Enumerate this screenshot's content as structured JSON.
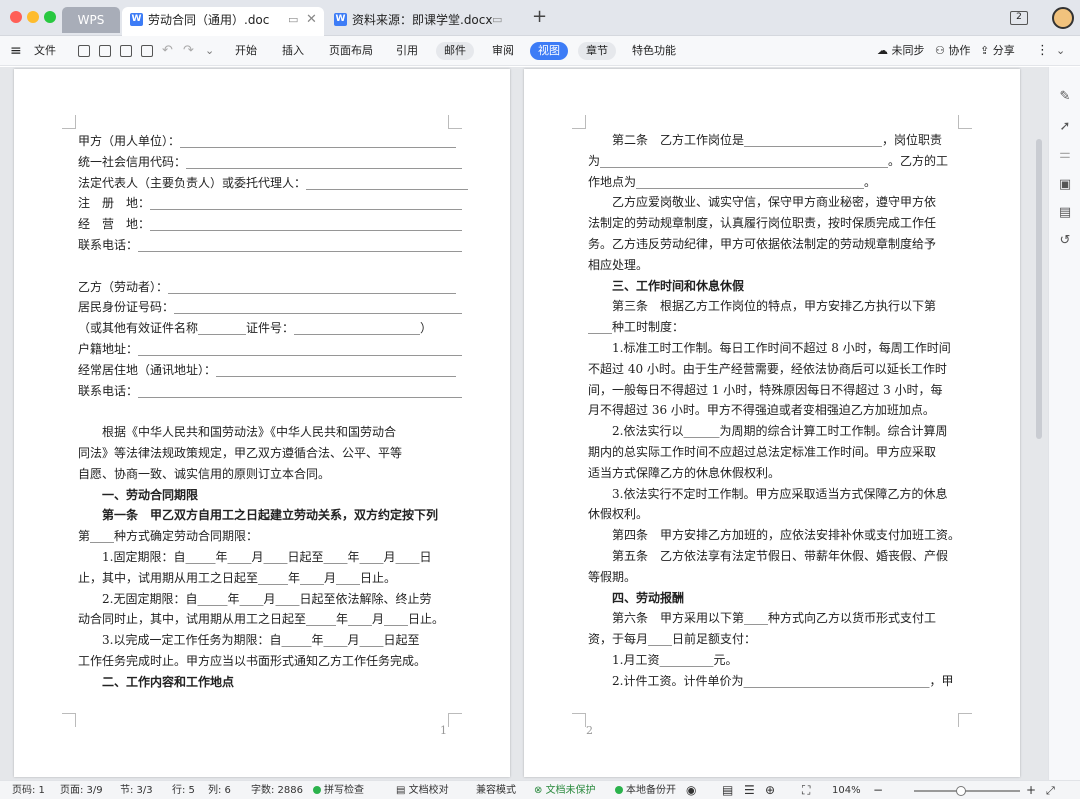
{
  "app": {
    "name": "WPS"
  },
  "tabs": [
    {
      "label": "劳动合同（通用）.doc",
      "icon": "word-doc-icon"
    },
    {
      "label": "资料来源：即课学堂.docx",
      "icon": "word-doc-icon"
    }
  ],
  "titlebar": {
    "badge": "2"
  },
  "menu": {
    "file": "文件",
    "items": [
      "开始",
      "插入",
      "页面布局",
      "引用",
      "邮件",
      "审阅",
      "视图",
      "章节",
      "特色功能"
    ],
    "active": "视图",
    "sync": "未同步",
    "collab": "协作",
    "share": "分享"
  },
  "page1": {
    "lines": [
      "甲方（用人单位）：______________________________________________",
      "统一社会信用代码：______________________________________________",
      "法定代表人（主要负责人）或委托代理人：___________________________",
      "注　册　地：____________________________________________________",
      "经　营　地：____________________________________________________",
      "联系电话：______________________________________________________",
      "",
      "乙方（劳动者）：________________________________________________",
      "居民身份证号码：________________________________________________",
      "（或其他有效证件名称________证件号：_____________________）",
      "户籍地址：______________________________________________________",
      "经常居住地（通讯地址）：________________________________________",
      "联系电话：______________________________________________________",
      "",
      "　　根据《中华人民共和国劳动法》《中华人民共和国劳动合",
      "同法》等法律法规政策规定，甲乙双方遵循合法、公平、平等",
      "自愿、协商一致、诚实信用的原则订立本合同。",
      "　　一、劳动合同期限",
      "　　第一条　甲乙双方自用工之日起建立劳动关系，双方约定按下列",
      "第____种方式确定劳动合同期限：",
      "　　1.固定期限：自_____年____月____日起至____年____月____日",
      "止，其中，试用期从用工之日起至_____年____月____日止。",
      "　　2.无固定期限：自_____年____月____日起至依法解除、终止劳",
      "动合同时止，其中，试用期从用工之日起至_____年____月____日止。",
      "　　3.以完成一定工作任务为期限：自_____年____月____日起至",
      "工作任务完成时止。甲方应当以书面形式通知乙方工作任务完成。",
      "　　二、工作内容和工作地点"
    ],
    "bold": [
      17,
      18,
      26
    ],
    "page_number": "1"
  },
  "page2": {
    "lines": [
      "　　第二条　乙方工作岗位是_______________________，岗位职责",
      "为________________________________________________。乙方的工",
      "作地点为______________________________________。",
      "　　乙方应爱岗敬业、诚实守信，保守甲方商业秘密，遵守甲方依",
      "法制定的劳动规章制度，认真履行岗位职责，按时保质完成工作任",
      "务。乙方违反劳动纪律，甲方可依据依法制定的劳动规章制度给予",
      "相应处理。",
      "　　三、工作时间和休息休假",
      "　　第三条　根据乙方工作岗位的特点，甲方安排乙方执行以下第",
      "____种工时制度：",
      "　　1.标准工时工作制。每日工作时间不超过 8 小时，每周工作时间",
      "不超过 40 小时。由于生产经营需要，经依法协商后可以延长工作时",
      "间，一般每日不得超过 1 小时，特殊原因每日不得超过 3 小时，每",
      "月不得超过 36 小时。甲方不得强迫或者变相强迫乙方加班加点。",
      "　　2.依法实行以______为周期的综合计算工时工作制。综合计算周",
      "期内的总实际工作时间不应超过总法定标准工作时间。甲方应采取",
      "适当方式保障乙方的休息休假权利。",
      "　　3.依法实行不定时工作制。甲方应采取适当方式保障乙方的休息",
      "休假权利。",
      "　　第四条　甲方安排乙方加班的，应依法安排补休或支付加班工资。",
      "　　第五条　乙方依法享有法定节假日、带薪年休假、婚丧假、产假",
      "等假期。",
      "　　四、劳动报酬",
      "　　第六条　甲方采用以下第____种方式向乙方以货币形式支付工",
      "资，于每月____日前足额支付：",
      "　　1.月工资_________元。",
      "　　2.计件工资。计件单价为_______________________________，甲"
    ],
    "bold": [
      7,
      22
    ],
    "page_number": "2"
  },
  "status": {
    "page_code": "页码: 1",
    "pages": "页面: 3/9",
    "section": "节: 3/3",
    "row": "行: 5",
    "col": "列: 6",
    "words": "字数: 2886",
    "spell": "拼写检查",
    "proof": "文档校对",
    "compat": "兼容模式",
    "protect": "文档未保护",
    "backup": "本地备份开",
    "zoom": "104%"
  },
  "colors": {
    "accent": "#3d7cf6",
    "green": "#2bb24c"
  }
}
